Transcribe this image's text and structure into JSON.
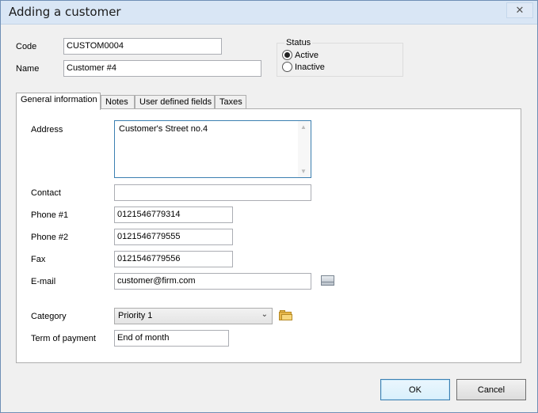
{
  "window": {
    "title": "Adding a customer"
  },
  "header": {
    "code_label": "Code",
    "code_value": "CUSTOM0004",
    "name_label": "Name",
    "name_value": "Customer #4"
  },
  "status": {
    "title": "Status",
    "options": [
      {
        "label": "Active",
        "selected": true
      },
      {
        "label": "Inactive",
        "selected": false
      }
    ]
  },
  "tabs": [
    {
      "label": "General information",
      "active": true
    },
    {
      "label": "Notes",
      "active": false
    },
    {
      "label": "User defined fields",
      "active": false
    },
    {
      "label": "Taxes",
      "active": false
    }
  ],
  "general": {
    "address_label": "Address",
    "address_value": "Customer's Street no.4",
    "contact_label": "Contact",
    "contact_value": "",
    "phone1_label": "Phone #1",
    "phone1_value": "0121546779314",
    "phone2_label": "Phone #2",
    "phone2_value": "0121546779555",
    "fax_label": "Fax",
    "fax_value": "0121546779556",
    "email_label": "E-mail",
    "email_value": "customer@firm.com",
    "category_label": "Category",
    "category_value": "Priority 1",
    "term_label": "Term of payment",
    "term_value": "End of month"
  },
  "icons": {
    "close": "close-icon",
    "email": "envelope-icon",
    "category_browse": "folder-icon",
    "dropdown": "chevron-down-icon"
  },
  "footer": {
    "ok_label": "OK",
    "cancel_label": "Cancel"
  },
  "colors": {
    "titlebar": "#d9e6f5",
    "focus_border": "#3c7fb1"
  }
}
